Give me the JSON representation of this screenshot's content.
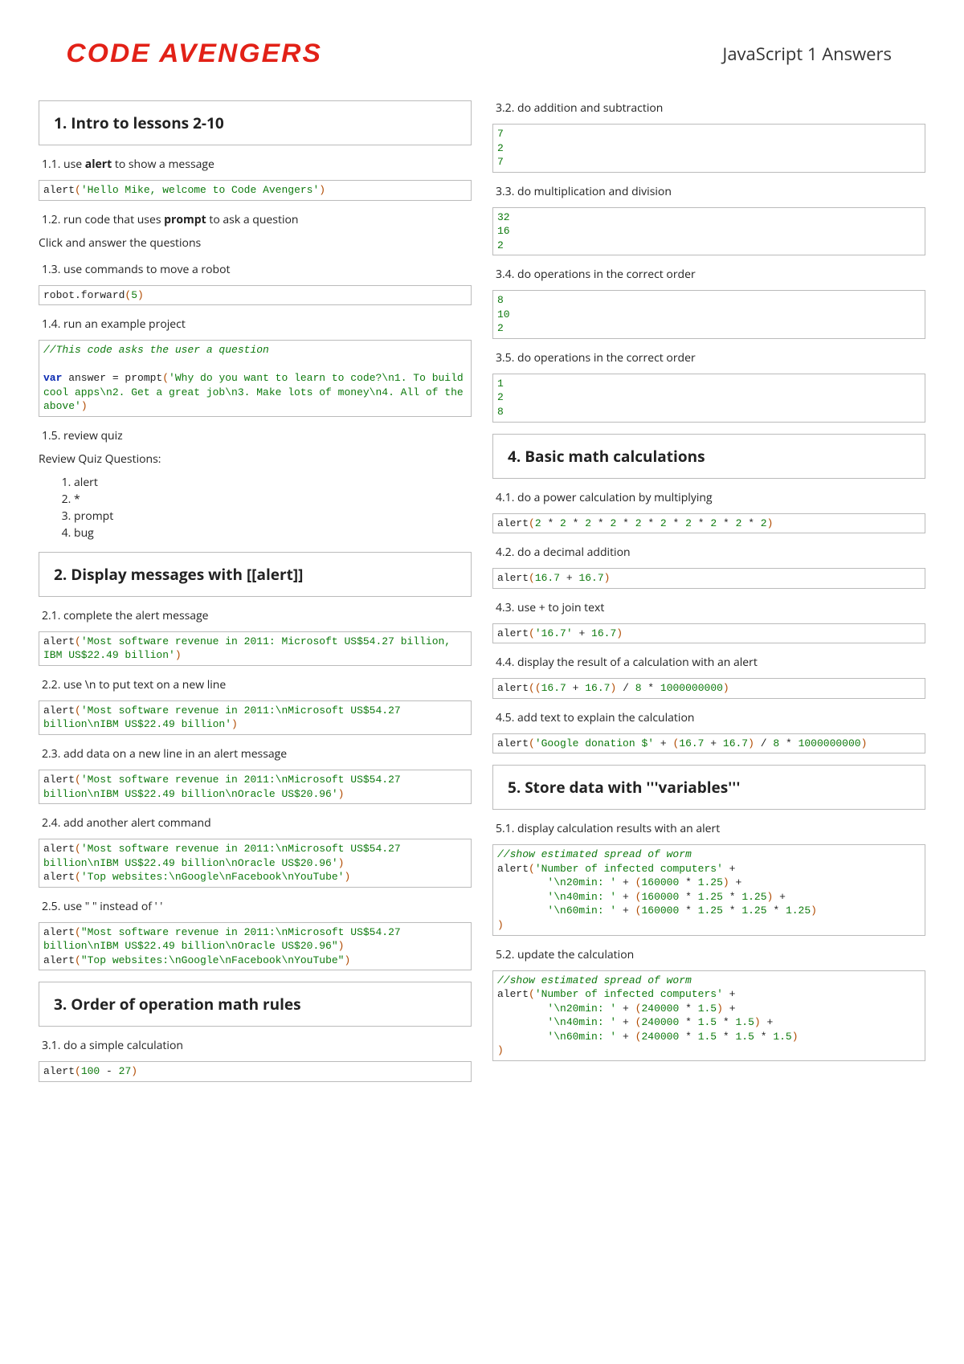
{
  "brand": "CODE AVENGERS",
  "page_title": "JavaScript 1 Answers",
  "columns": [
    {
      "title": "1. Intro to lessons 2-10",
      "items": [
        {
          "sub_html": "1.1. use <b>alert</b> to show a message",
          "code_html": "alert<span class='p'>(</span><span class='str'>'Hello Mike, welcome to Code Avengers'</span><span class='p'>)</span>"
        },
        {
          "sub_html": "1.2. run code that uses <b>prompt</b> to ask a question",
          "plain": "Click and answer the questions"
        },
        {
          "sub_html": "1.3. use commands to move a robot",
          "code_html": "robot.forward<span class='p'>(</span><span class='num'>5</span><span class='p'>)</span>"
        },
        {
          "sub_html": "1.4. run an example project",
          "code_html": "<span class='cm'>//This code asks the user a question</span>\n\n<span class='kw'>var</span> answer = prompt<span class='p'>(</span><span class='str'>'Why do you want to learn to code?\\n1. To build cool apps\\n2. Get a great job\\n3. Make lots of money\\n4. All of the above'</span><span class='p'>)</span>"
        },
        {
          "sub_html": "1.5. review quiz",
          "plain": "Review Quiz Questions:",
          "list": [
            "alert",
            "*",
            "prompt",
            "bug"
          ]
        }
      ]
    },
    {
      "title": "2. Display messages with [[alert]]",
      "items": [
        {
          "sub_html": "2.1. complete the alert message",
          "code_html": "alert<span class='p'>(</span><span class='str'>'Most software revenue in 2011: Microsoft US$54.27 billion, IBM US$22.49 billion'</span><span class='p'>)</span>"
        },
        {
          "sub_html": "2.2. use \\n to put text on a new line",
          "code_html": "alert<span class='p'>(</span><span class='str'>'Most software revenue in 2011:\\nMicrosoft US$54.27 billion\\nIBM US$22.49 billion'</span><span class='p'>)</span>"
        },
        {
          "sub_html": "2.3. add data on a new line in an alert message",
          "code_html": "alert<span class='p'>(</span><span class='str'>'Most software revenue in 2011:\\nMicrosoft US$54.27 billion\\nIBM US$22.49 billion\\nOracle US$20.96'</span><span class='p'>)</span>"
        },
        {
          "sub_html": "2.4. add another alert command",
          "code_html": "alert<span class='p'>(</span><span class='str'>'Most software revenue in 2011:\\nMicrosoft US$54.27 billion\\nIBM US$22.49 billion\\nOracle US$20.96'</span><span class='p'>)</span>\nalert<span class='p'>(</span><span class='str'>'Top websites:\\nGoogle\\nFacebook\\nYouTube'</span><span class='p'>)</span>"
        },
        {
          "sub_html": "2.5. use \" \" instead of ' '",
          "code_html": "alert<span class='p'>(</span><span class='str'>\"Most software revenue in 2011:\\nMicrosoft US$54.27 billion\\nIBM US$22.49 billion\\nOracle US$20.96\"</span><span class='p'>)</span>\nalert<span class='p'>(</span><span class='str'>\"Top websites:\\nGoogle\\nFacebook\\nYouTube\"</span><span class='p'>)</span>"
        }
      ]
    },
    {
      "title": "3. Order of operation math rules",
      "items": [
        {
          "sub_html": "3.1. do a simple calculation",
          "code_html": "alert<span class='p'>(</span><span class='num'>100</span> - <span class='num'>27</span><span class='p'>)</span>"
        },
        {
          "sub_html": "3.2. do addition and subtraction",
          "code_html": "<span class='num'>7</span>\n<span class='num'>2</span>\n<span class='num'>7</span>"
        },
        {
          "sub_html": "3.3. do multiplication and division",
          "code_html": "<span class='num'>32</span>\n<span class='num'>16</span>\n<span class='num'>2</span>"
        },
        {
          "sub_html": "3.4. do operations in the correct order",
          "code_html": "<span class='num'>8</span>\n<span class='num'>10</span>\n<span class='num'>2</span>"
        },
        {
          "sub_html": "3.5. do operations in the correct order",
          "code_html": "<span class='num'>1</span>\n<span class='num'>2</span>\n<span class='num'>8</span>"
        }
      ]
    },
    {
      "title": "4. Basic math calculations",
      "items": [
        {
          "sub_html": "4.1. do a power calculation by multiplying",
          "code_html": "alert<span class='p'>(</span><span class='num'>2</span> * <span class='num'>2</span> * <span class='num'>2</span> * <span class='num'>2</span> * <span class='num'>2</span> * <span class='num'>2</span> * <span class='num'>2</span> * <span class='num'>2</span> * <span class='num'>2</span> * <span class='num'>2</span><span class='p'>)</span>"
        },
        {
          "sub_html": "4.2. do a decimal addition",
          "code_html": "alert<span class='p'>(</span><span class='num'>16.7</span> + <span class='num'>16.7</span><span class='p'>)</span>"
        },
        {
          "sub_html": "4.3. use + to join text",
          "code_html": "alert<span class='p'>(</span><span class='str'>'16.7'</span> + <span class='num'>16.7</span><span class='p'>)</span>"
        },
        {
          "sub_html": "4.4. display the result of a calculation with an alert",
          "code_html": "alert<span class='p'>((</span><span class='num'>16.7</span> + <span class='num'>16.7</span><span class='p'>)</span> / <span class='num'>8</span> * <span class='num'>1000000000</span><span class='p'>)</span>"
        },
        {
          "sub_html": "4.5. add text to explain the calculation",
          "code_html": "alert<span class='p'>(</span><span class='str'>'Google donation $'</span> + <span class='p'>(</span><span class='num'>16.7</span> + <span class='num'>16.7</span><span class='p'>)</span> / <span class='num'>8</span> * <span class='num'>1000000000</span><span class='p'>)</span>"
        }
      ]
    },
    {
      "title": "5. Store data with '''variables'''",
      "items": [
        {
          "sub_html": "5.1. display calculation results with an alert",
          "code_html": "<span class='cm'>//show estimated spread of worm</span>\nalert<span class='p'>(</span><span class='str'>'Number of infected computers'</span> +\n        <span class='str'>'\\n20min: '</span> + <span class='p'>(</span><span class='num'>160000</span> * <span class='num'>1.25</span><span class='p'>)</span> +\n        <span class='str'>'\\n40min: '</span> + <span class='p'>(</span><span class='num'>160000</span> * <span class='num'>1.25</span> * <span class='num'>1.25</span><span class='p'>)</span> +\n        <span class='str'>'\\n60min: '</span> + <span class='p'>(</span><span class='num'>160000</span> * <span class='num'>1.25</span> * <span class='num'>1.25</span> * <span class='num'>1.25</span><span class='p'>)</span>\n<span class='p'>)</span>"
        },
        {
          "sub_html": "5.2. update the calculation",
          "code_html": "<span class='cm'>//show estimated spread of worm</span>\nalert<span class='p'>(</span><span class='str'>'Number of infected computers'</span> +\n        <span class='str'>'\\n20min: '</span> + <span class='p'>(</span><span class='num'>240000</span> * <span class='num'>1.5</span><span class='p'>)</span> +\n        <span class='str'>'\\n40min: '</span> + <span class='p'>(</span><span class='num'>240000</span> * <span class='num'>1.5</span> * <span class='num'>1.5</span><span class='p'>)</span> +\n        <span class='str'>'\\n60min: '</span> + <span class='p'>(</span><span class='num'>240000</span> * <span class='num'>1.5</span> * <span class='num'>1.5</span> * <span class='num'>1.5</span><span class='p'>)</span>\n<span class='p'>)</span>"
        }
      ]
    }
  ]
}
